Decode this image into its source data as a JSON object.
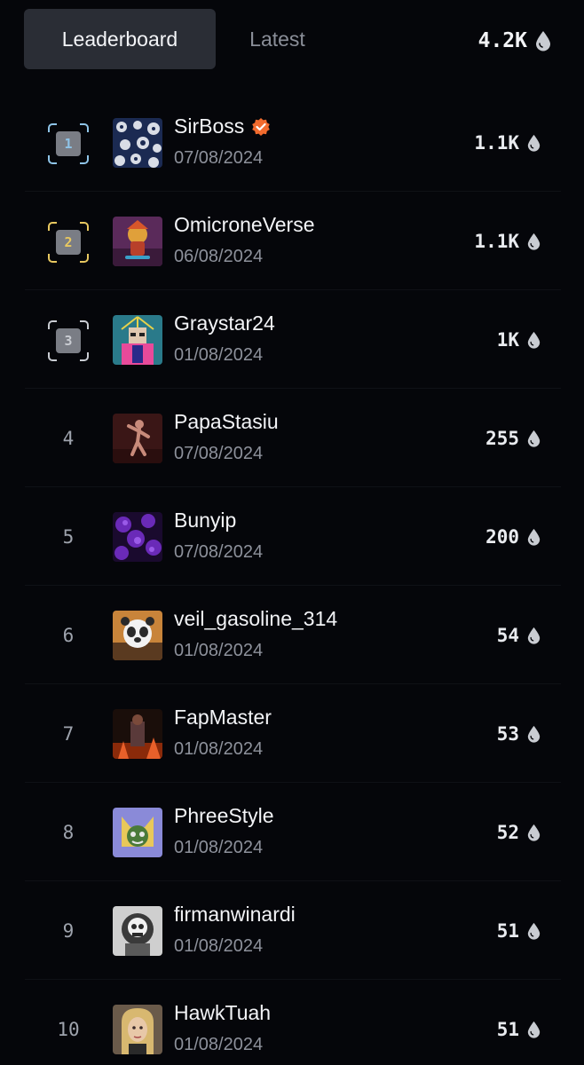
{
  "tabs": {
    "leaderboard": "Leaderboard",
    "latest": "Latest"
  },
  "total": {
    "value": "4.2K",
    "icon": "drop-icon"
  },
  "colors": {
    "background": "#05060a",
    "rank1": "#8fc4e8",
    "rank2": "#e8c860",
    "rank3": "#c9ccd2",
    "verified": "#f26b2e"
  },
  "rows": [
    {
      "rank": "1",
      "name": "SirBoss",
      "verified": true,
      "date": "07/08/2024",
      "score": "1.1K"
    },
    {
      "rank": "2",
      "name": "OmicroneVerse",
      "verified": false,
      "date": "06/08/2024",
      "score": "1.1K"
    },
    {
      "rank": "3",
      "name": "Graystar24",
      "verified": false,
      "date": "01/08/2024",
      "score": "1K"
    },
    {
      "rank": "4",
      "name": "PapaStasiu",
      "verified": false,
      "date": "07/08/2024",
      "score": "255"
    },
    {
      "rank": "5",
      "name": "Bunyip",
      "verified": false,
      "date": "07/08/2024",
      "score": "200"
    },
    {
      "rank": "6",
      "name": "veil_gasoline_314",
      "verified": false,
      "date": "01/08/2024",
      "score": "54"
    },
    {
      "rank": "7",
      "name": "FapMaster",
      "verified": false,
      "date": "01/08/2024",
      "score": "53"
    },
    {
      "rank": "8",
      "name": "PhreeStyle",
      "verified": false,
      "date": "01/08/2024",
      "score": "52"
    },
    {
      "rank": "9",
      "name": "firmanwinardi",
      "verified": false,
      "date": "01/08/2024",
      "score": "51"
    },
    {
      "rank": "10",
      "name": "HawkTuah",
      "verified": false,
      "date": "01/08/2024",
      "score": "51"
    }
  ]
}
